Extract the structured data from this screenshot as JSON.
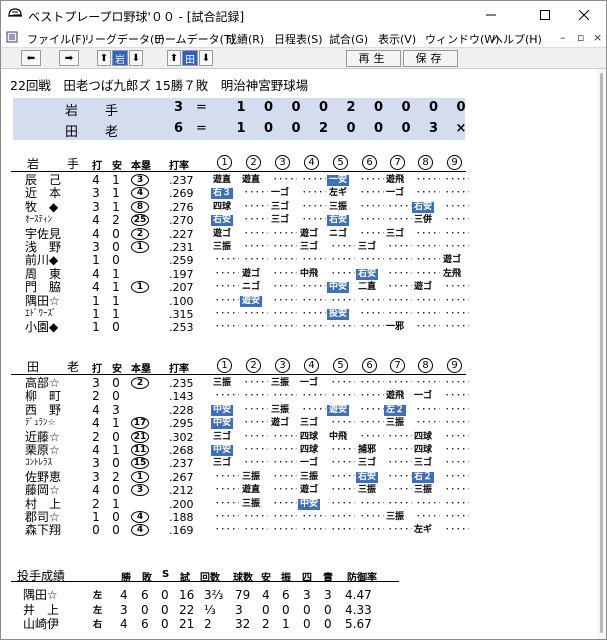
{
  "window": {
    "title": "ベストプレープロ野球'００ - [試合記録]"
  },
  "menu": [
    "ファイル(F)",
    "リーグデータ(L)",
    "チームデータ(T)",
    "成績(R)",
    "日程表(S)",
    "試合(G)",
    "表示(V)",
    "ウィンドウ(W)",
    "ヘルプ(H)"
  ],
  "toolbar": {
    "team1": "岩",
    "team2": "田",
    "play": "再生",
    "save": "保存"
  },
  "game": {
    "info": "22回戦　田老つば九郎ズ 15勝７敗　明治神宮野球場"
  },
  "linescore": [
    {
      "team": [
        "岩",
        "手"
      ],
      "score": "3",
      "innings": [
        "1",
        "0",
        "0",
        "0",
        "2",
        "0",
        "0",
        "0",
        "0"
      ]
    },
    {
      "team": [
        "田",
        "老"
      ],
      "score": "6",
      "innings": [
        "1",
        "0",
        "0",
        "2",
        "0",
        "0",
        "0",
        "3",
        "×"
      ]
    }
  ],
  "cols": {
    "ab": "打",
    "h": "安",
    "hr": "本塁",
    "avg": "打率",
    "innings": [
      "1",
      "2",
      "3",
      "4",
      "5",
      "6",
      "7",
      "8",
      "9"
    ]
  },
  "away": {
    "team": [
      "岩",
      "手"
    ],
    "players": [
      {
        "name": "辰　己",
        "ab": "4",
        "h": "1",
        "hr": "3",
        "avg": ".237",
        "pa": [
          [
            "遊直",
            0
          ],
          [
            "遊直",
            0
          ],
          null,
          null,
          [
            "一安",
            1
          ],
          null,
          [
            "遊飛",
            0
          ],
          null,
          null
        ]
      },
      {
        "name": "近　本",
        "ab": "3",
        "h": "1",
        "hr": "4",
        "avg": ".269",
        "pa": [
          [
            "右３",
            1
          ],
          null,
          [
            "一ゴ",
            0
          ],
          null,
          [
            "左ギ",
            0
          ],
          null,
          [
            "一ゴ",
            0
          ],
          null,
          null
        ]
      },
      {
        "name": "牧　◆",
        "ab": "3",
        "h": "1",
        "hr": "8",
        "avg": ".276",
        "pa": [
          [
            "四球",
            0
          ],
          null,
          [
            "三ゴ",
            0
          ],
          null,
          [
            "三振",
            0
          ],
          null,
          null,
          [
            "右安",
            1
          ],
          null
        ]
      },
      {
        "name": "ｵｰｽﾃｨﾝ",
        "small": true,
        "ab": "4",
        "h": "2",
        "hr": "25",
        "avg": ".270",
        "pa": [
          [
            "右安",
            1
          ],
          null,
          [
            "三ゴ",
            0
          ],
          null,
          [
            "右安",
            1
          ],
          null,
          null,
          [
            "三併",
            0
          ],
          null
        ]
      },
      {
        "name": "宇佐見",
        "ab": "4",
        "h": "0",
        "hr": "2",
        "avg": ".227",
        "pa": [
          [
            "遊ゴ",
            0
          ],
          null,
          null,
          [
            "遊ゴ",
            0
          ],
          [
            "ニゴ",
            0
          ],
          null,
          [
            "三ゴ",
            0
          ],
          null,
          null
        ]
      },
      {
        "name": "浅　野",
        "ab": "3",
        "h": "0",
        "hr": "1",
        "avg": ".231",
        "pa": [
          [
            "三振",
            0
          ],
          null,
          null,
          [
            "三ゴ",
            0
          ],
          null,
          [
            "三ゴ",
            0
          ],
          null,
          null,
          null
        ]
      },
      {
        "name": "前川◆",
        "ab": "1",
        "h": "0",
        "hr": "",
        "avg": ".259",
        "pa": [
          null,
          null,
          null,
          null,
          null,
          null,
          null,
          null,
          [
            "遊ゴ",
            0
          ]
        ]
      },
      {
        "name": "周　東",
        "ab": "4",
        "h": "1",
        "hr": "",
        "avg": ".197",
        "pa": [
          null,
          [
            "遊ゴ",
            0
          ],
          null,
          [
            "中飛",
            0
          ],
          null,
          [
            "右安",
            1
          ],
          null,
          null,
          [
            "左飛",
            0
          ]
        ]
      },
      {
        "name": "門　脇",
        "ab": "4",
        "h": "1",
        "hr": "1",
        "avg": ".207",
        "pa": [
          null,
          [
            "ニゴ",
            0
          ],
          null,
          null,
          [
            "中安",
            1
          ],
          [
            "二直",
            0
          ],
          null,
          [
            "遊ゴ",
            0
          ],
          null
        ]
      },
      {
        "name": "隅田☆",
        "ab": "1",
        "h": "1",
        "hr": "",
        "avg": ".100",
        "pa": [
          null,
          [
            "遊安",
            1
          ],
          null,
          null,
          null,
          null,
          null,
          null,
          null
        ]
      },
      {
        "name": "ｴﾄﾞﾜｰｽﾞ",
        "small": true,
        "ab": "1",
        "h": "1",
        "hr": "",
        "avg": ".315",
        "pa": [
          null,
          null,
          null,
          null,
          [
            "投安",
            1
          ],
          null,
          null,
          null,
          null
        ]
      },
      {
        "name": "小園◆",
        "ab": "1",
        "h": "0",
        "hr": "",
        "avg": ".253",
        "pa": [
          null,
          null,
          null,
          null,
          null,
          null,
          [
            "一邪",
            0
          ],
          null,
          null
        ]
      }
    ]
  },
  "home": {
    "team": [
      "田",
      "老"
    ],
    "players": [
      {
        "name": "高部☆",
        "ab": "3",
        "h": "0",
        "hr": "2",
        "avg": ".235",
        "pa": [
          [
            "三振",
            0
          ],
          null,
          [
            "三振",
            0
          ],
          [
            "一ゴ",
            0
          ],
          null,
          null,
          null,
          null,
          null
        ]
      },
      {
        "name": "柳　町",
        "ab": "2",
        "h": "0",
        "hr": "",
        "avg": ".143",
        "pa": [
          null,
          null,
          null,
          null,
          null,
          null,
          [
            "遊飛",
            0
          ],
          [
            "一ゴ",
            0
          ],
          null
        ]
      },
      {
        "name": "西　野",
        "ab": "4",
        "h": "3",
        "hr": "",
        "avg": ".228",
        "pa": [
          [
            "中安",
            1
          ],
          null,
          [
            "三振",
            0
          ],
          null,
          [
            "遊安",
            1
          ],
          null,
          [
            "左２",
            1
          ],
          null,
          null
        ]
      },
      {
        "name": "ﾃﾞｭﾗﾝ☆",
        "small": true,
        "ab": "4",
        "h": "1",
        "hr": "17",
        "avg": ".295",
        "pa": [
          [
            "中安",
            1
          ],
          null,
          [
            "遊ゴ",
            0
          ],
          [
            "三ゴ",
            0
          ],
          null,
          null,
          [
            "三振",
            0
          ],
          null,
          null
        ]
      },
      {
        "name": "近藤☆",
        "ab": "2",
        "h": "0",
        "hr": "21",
        "avg": ".302",
        "pa": [
          [
            "三ゴ",
            0
          ],
          null,
          null,
          [
            "四球",
            0
          ],
          [
            "中飛",
            0
          ],
          null,
          null,
          [
            "四球",
            0
          ],
          null
        ]
      },
      {
        "name": "栗原☆",
        "ab": "4",
        "h": "1",
        "hr": "11",
        "avg": ".268",
        "pa": [
          [
            "中安",
            1
          ],
          null,
          null,
          [
            "四球",
            0
          ],
          null,
          [
            "捕邪",
            0
          ],
          null,
          [
            "四球",
            0
          ],
          null
        ]
      },
      {
        "name": "ｺﾝﾄﾚﾗｽ",
        "small": true,
        "ab": "3",
        "h": "0",
        "hr": "15",
        "avg": ".237",
        "pa": [
          [
            "三ゴ",
            0
          ],
          null,
          null,
          [
            "一ゴ",
            0
          ],
          null,
          [
            "三ゴ",
            0
          ],
          null,
          [
            "三ゴ",
            0
          ],
          null
        ]
      },
      {
        "name": "佐野恵",
        "ab": "3",
        "h": "2",
        "hr": "1",
        "avg": ".267",
        "pa": [
          null,
          [
            "三振",
            0
          ],
          null,
          [
            "三振",
            0
          ],
          null,
          [
            "右安",
            1
          ],
          null,
          [
            "右２",
            1
          ],
          null
        ]
      },
      {
        "name": "藤岡☆",
        "ab": "4",
        "h": "0",
        "hr": "3",
        "avg": ".212",
        "pa": [
          null,
          [
            "遊直",
            0
          ],
          null,
          [
            "遊ゴ",
            0
          ],
          null,
          [
            "三振",
            0
          ],
          null,
          [
            "三振",
            0
          ],
          null
        ]
      },
      {
        "name": "村　上",
        "ab": "2",
        "h": "1",
        "hr": "",
        "avg": ".200",
        "pa": [
          null,
          [
            "三振",
            0
          ],
          null,
          [
            "中安",
            1
          ],
          null,
          null,
          null,
          null,
          null
        ]
      },
      {
        "name": "郡司☆",
        "ab": "1",
        "h": "0",
        "hr": "4",
        "avg": ".188",
        "pa": [
          null,
          null,
          null,
          null,
          null,
          null,
          [
            "三振",
            0
          ],
          null,
          null
        ]
      },
      {
        "name": "森下翔",
        "ab": "0",
        "h": "0",
        "hr": "4",
        "avg": ".169",
        "pa": [
          null,
          null,
          null,
          null,
          null,
          null,
          null,
          [
            "左ギ",
            0
          ],
          null
        ]
      }
    ]
  },
  "pitching": {
    "title": "投手成績",
    "headers": [
      "勝",
      "敗",
      "S",
      "試",
      "回数",
      "球数",
      "安",
      "振",
      "四",
      "責",
      "防御率"
    ],
    "rows": [
      {
        "name": "隅田☆",
        "hand": "左",
        "w": "4",
        "l": "6",
        "s": "0",
        "g": "16",
        "ip": "3⅔",
        "np": "79",
        "h": "4",
        "so": "6",
        "bb": "3",
        "er": "3",
        "era": "4.47"
      },
      {
        "name": "井　上",
        "hand": "左",
        "w": "3",
        "l": "0",
        "s": "0",
        "g": "22",
        "ip": "⅓",
        "np": "3",
        "h": "0",
        "so": "0",
        "bb": "0",
        "er": "0",
        "era": "4.33"
      },
      {
        "name": "山崎伊",
        "hand": "右",
        "w": "4",
        "l": "6",
        "s": "0",
        "g": "21",
        "ip": "2",
        "np": "32",
        "h": "2",
        "so": "1",
        "bb": "0",
        "er": "0",
        "era": "5.67"
      }
    ]
  }
}
